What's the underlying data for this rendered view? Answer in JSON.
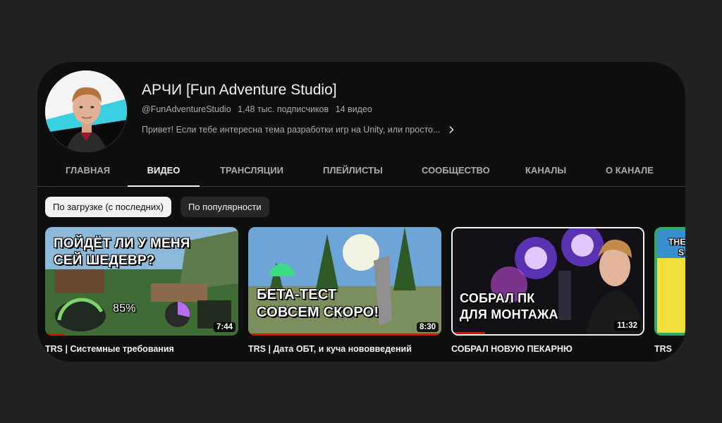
{
  "channel": {
    "name": "АРЧИ [Fun Adventure Studio]",
    "handle": "@FunAdventureStudio",
    "subscribers": "1,48 тыс. подписчиков",
    "video_count": "14 видео",
    "description": "Привет! Если тебе интересна тема разработки игр на Unity, или просто..."
  },
  "tabs": [
    {
      "label": "ГЛАВНАЯ",
      "active": false
    },
    {
      "label": "ВИДЕО",
      "active": true
    },
    {
      "label": "ТРАНСЛЯЦИИ",
      "active": false
    },
    {
      "label": "ПЛЕЙЛИСТЫ",
      "active": false
    },
    {
      "label": "СООБЩЕСТВО",
      "active": false
    },
    {
      "label": "КАНАЛЫ",
      "active": false
    },
    {
      "label": "О КАНАЛЕ",
      "active": false
    }
  ],
  "sort_chips": [
    {
      "label": "По загрузке (с последних)",
      "selected": true
    },
    {
      "label": "По популярности",
      "selected": false
    }
  ],
  "videos": [
    {
      "title": "TRS | Системные требования",
      "duration": "7:44",
      "thumb_text": [
        "ПОЙДЁТ ЛИ У МЕНЯ",
        "СЕЙ ШЕДЕВР?"
      ],
      "gauge_value": "85%",
      "watched_fraction": 0.1
    },
    {
      "title": "TRS | Дата ОБТ, и куча нововведений",
      "duration": "8:30",
      "thumb_text": [
        "БЕТА-ТЕСТ",
        "СОВСЕМ СКОРО!"
      ],
      "watched_fraction": 1.0
    },
    {
      "title": "СОБРАЛ НОВУЮ ПЕКАРНЮ",
      "duration": "11:32",
      "thumb_text": [
        "СОБРАЛ ПК",
        "ДЛЯ МОНТАЖА"
      ],
      "watched_fraction": 0.17
    },
    {
      "title": "TRS",
      "thumb_text": [
        "THE",
        "S"
      ]
    }
  ],
  "colors": {
    "background": "#0f0f0f",
    "page": "#212121",
    "text": "#f1f1f1",
    "muted": "#aaaaaa",
    "progress": "#ff0000"
  }
}
